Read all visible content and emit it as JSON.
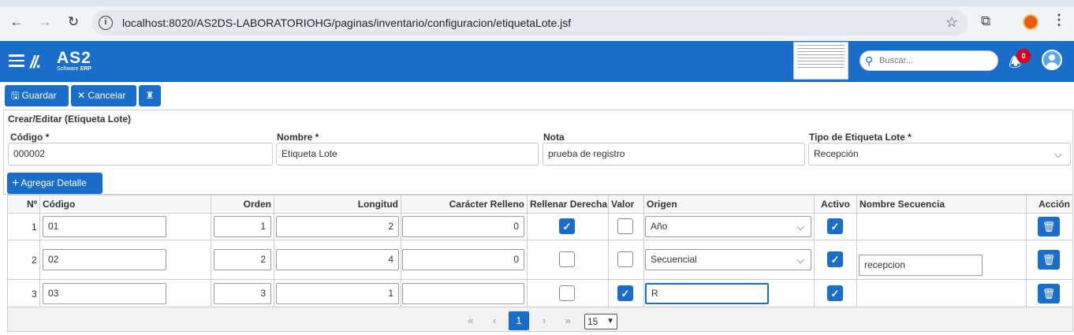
{
  "browser": {
    "url": "localhost:8020/AS2DS-LABORATORIOHG/paginas/inventario/configuracion/etiquetaLote.jsf",
    "back_icon": "←",
    "forward_icon": "→",
    "reload_icon": "↻",
    "info_icon": "i",
    "star_icon": "☆",
    "extensions_icon": "⧉",
    "menu_icon": "⋮"
  },
  "header": {
    "logo_mark": "//.",
    "logo_name": "AS2",
    "logo_sub_prefix": "Software ",
    "logo_sub_bold": "ERP",
    "search_placeholder": "Buscar...",
    "notification_count": "0"
  },
  "toolbar": {
    "save_label": "Guardar",
    "cancel_label": "Cancelar",
    "save_icon": "🖫",
    "cancel_icon": "✕",
    "extra_icon": "♜"
  },
  "form": {
    "title": "Crear/Editar (Etiqueta Lote)",
    "codigo_label": "Código *",
    "codigo_value": "000002",
    "nombre_label": "Nombre *",
    "nombre_value": "Etiqueta Lote",
    "nota_label": "Nota",
    "nota_value": "prueba de registro",
    "tipo_label": "Tipo de Etiqueta Lote  *",
    "tipo_value": "Recepción"
  },
  "detail": {
    "add_label": "Agregar Detalle",
    "columns": {
      "num": "Nº",
      "codigo": "Código",
      "orden": "Orden",
      "longitud": "Longitud",
      "caracter": "Carácter Relleno",
      "rellenar": "Rellenar Derecha",
      "valor": "Valor",
      "origen": "Origen",
      "activo": "Activo",
      "secuencia": "Nombre Secuencia",
      "accion": "Acción"
    },
    "rows": [
      {
        "num": "1",
        "codigo": "01",
        "orden": "1",
        "longitud": "2",
        "caracter": "0",
        "rellenar": true,
        "valor": false,
        "origen": "Año",
        "origen_type": "select",
        "activo": true,
        "secuencia": ""
      },
      {
        "num": "2",
        "codigo": "02",
        "orden": "2",
        "longitud": "4",
        "caracter": "0",
        "rellenar": false,
        "valor": false,
        "origen": "Secuencial",
        "origen_type": "select",
        "activo": true,
        "secuencia": "recepcion"
      },
      {
        "num": "3",
        "codigo": "03",
        "orden": "3",
        "longitud": "1",
        "caracter": "",
        "rellenar": false,
        "valor": true,
        "origen": "R",
        "origen_type": "text",
        "activo": true,
        "secuencia": ""
      }
    ],
    "check_mark": "✓",
    "trash_icon": "🗑",
    "chevron": "⌵"
  },
  "pagination": {
    "first": "«",
    "prev": "‹",
    "current": "1",
    "next": "›",
    "last": "»",
    "per_page": "15"
  },
  "colors": {
    "primary": "#1a6ec9",
    "badge": "#d9001b"
  }
}
